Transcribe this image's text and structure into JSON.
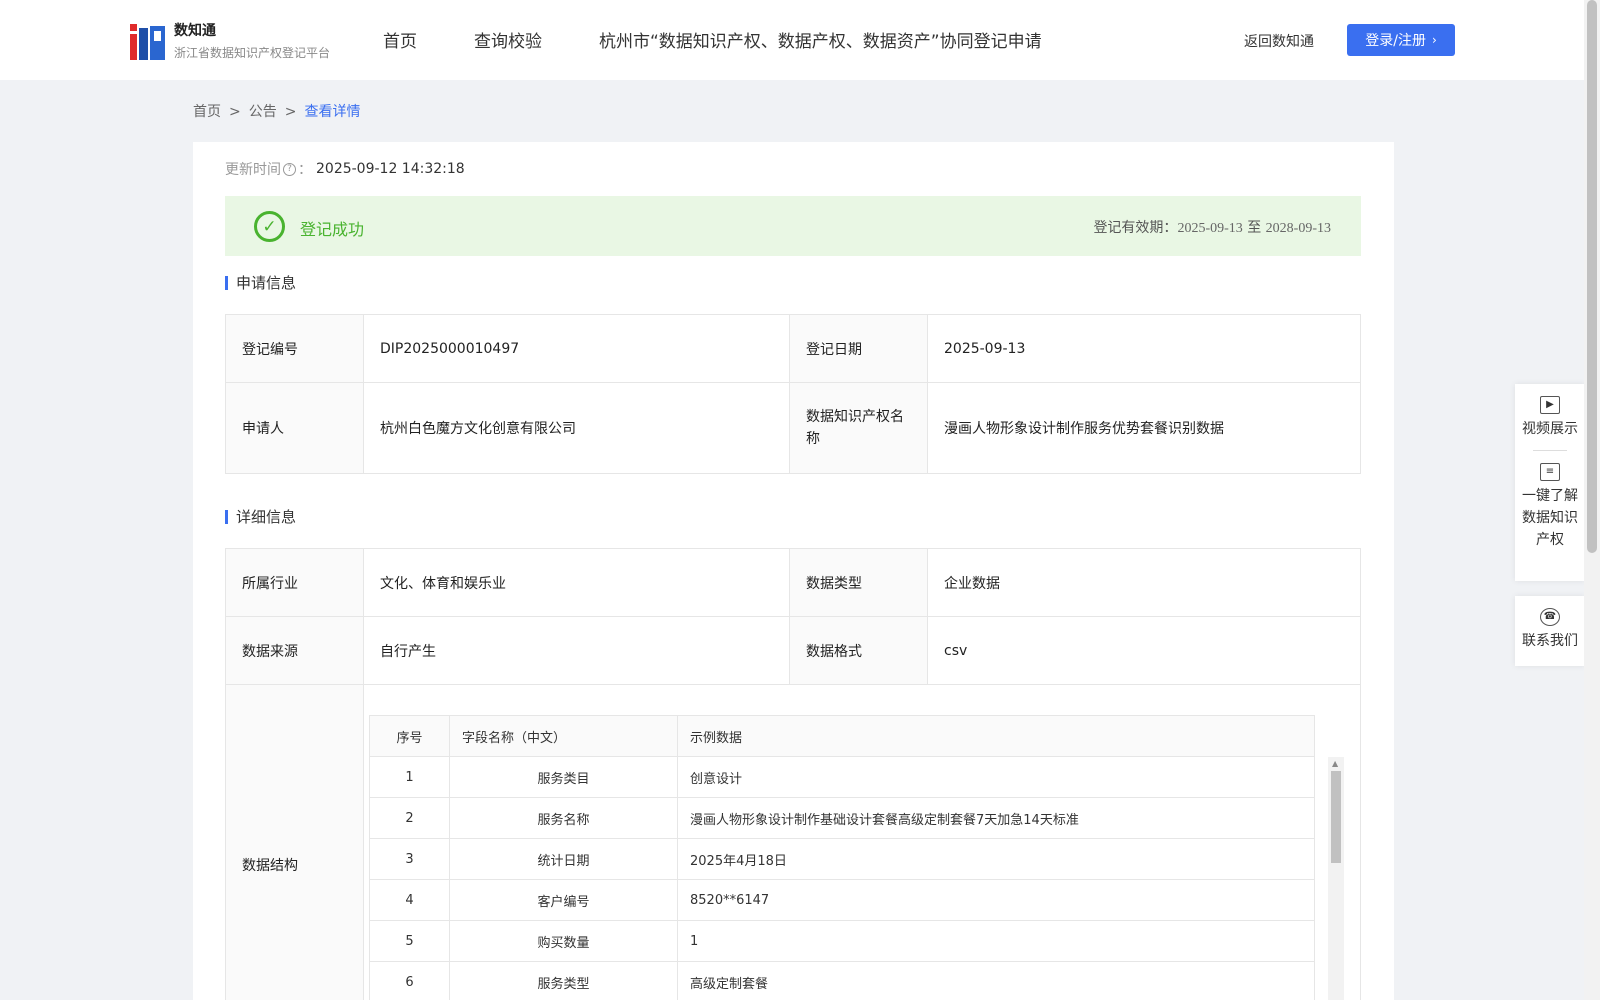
{
  "header": {
    "logo_title": "数知通",
    "logo_subtitle": "浙江省数据知识产权登记平台",
    "nav": [
      "首页",
      "查询校验",
      "杭州市“数据知识产权、数据产权、数据资产”协同登记申请"
    ],
    "back_link": "返回数知通",
    "login_button": "登录/注册",
    "accent_color": "#3a6ff0"
  },
  "breadcrumb": {
    "home": "首页",
    "notice": "公告",
    "current": "查看详情",
    "separator": ">"
  },
  "update": {
    "label": "更新时间",
    "colon": "：",
    "value": "2025-09-12 14:32:18"
  },
  "status": {
    "text": "登记成功",
    "validity_label": "登记有效期：",
    "start": "2025-09-13",
    "to": "至",
    "end": "2028-09-13",
    "color": "#49b32f"
  },
  "apply_section": {
    "title": "申请信息",
    "reg_no_label": "登记编号",
    "reg_no": "DIP2025000010497",
    "reg_date_label": "登记日期",
    "reg_date": "2025-09-13",
    "applicant_label": "申请人",
    "applicant": "杭州白色魔方文化创意有限公司",
    "ip_name_label": "数据知识产权名称",
    "ip_name": "漫画人物形象设计制作服务优势套餐识别数据"
  },
  "detail_section": {
    "title": "详细信息",
    "industry_label": "所属行业",
    "industry": "文化、体育和娱乐业",
    "data_type_label": "数据类型",
    "data_type": "企业数据",
    "source_label": "数据来源",
    "source": "自行产生",
    "format_label": "数据格式",
    "format": "csv",
    "structure_label": "数据结构",
    "structure_headers": [
      "序号",
      "字段名称（中文）",
      "示例数据"
    ],
    "structure_rows": [
      [
        "1",
        "服务类目",
        "创意设计"
      ],
      [
        "2",
        "服务名称",
        "漫画人物形象设计制作基础设计套餐高级定制套餐7天加急14天标准"
      ],
      [
        "3",
        "统计日期",
        "2025年4月18日"
      ],
      [
        "4",
        "客户编号",
        "8520**6147"
      ],
      [
        "5",
        "购买数量",
        "1"
      ],
      [
        "6",
        "服务类型",
        "高级定制套餐"
      ]
    ]
  },
  "side_panel": {
    "video": "视频展示",
    "learn": "一键了解数据知识产权",
    "contact": "联系我们"
  }
}
